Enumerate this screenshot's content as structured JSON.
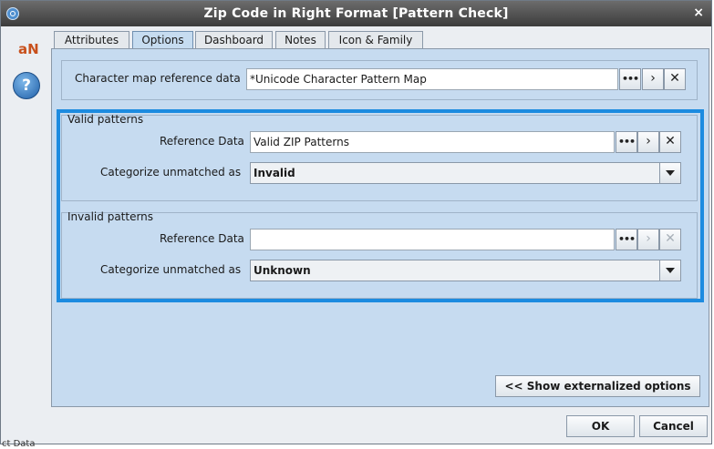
{
  "window": {
    "title": "Zip Code in Right Format [Pattern Check]",
    "close_symbol": "×",
    "title_icon": "app-icon"
  },
  "sidebar": {
    "logo_text": "aN",
    "help_symbol": "?"
  },
  "tabs": [
    {
      "label": "Attributes"
    },
    {
      "label": "Options",
      "active": true
    },
    {
      "label": "Dashboard"
    },
    {
      "label": "Notes"
    },
    {
      "label": "Icon & Family"
    }
  ],
  "options": {
    "char_map": {
      "label": "Character map reference data",
      "value": "*Unicode Character Pattern Map"
    },
    "valid_patterns": {
      "title": "Valid patterns",
      "ref_label": "Reference Data",
      "ref_value": "Valid ZIP Patterns",
      "unmatched_label": "Categorize unmatched as",
      "unmatched_value": "Invalid"
    },
    "invalid_patterns": {
      "title": "Invalid patterns",
      "ref_label": "Reference Data",
      "ref_value": "",
      "unmatched_label": "Categorize unmatched as",
      "unmatched_value": "Unknown"
    },
    "show_externalized_label": "<< Show externalized options"
  },
  "buttons": {
    "ellipsis": "•••",
    "navigate": "›",
    "clear": "✕"
  },
  "footer": {
    "ok_label": "OK",
    "cancel_label": "Cancel"
  },
  "background": {
    "fragment": "ct Data"
  },
  "colors": {
    "highlight": "#1c8be0",
    "panel": "#c6dbf0",
    "titlebar": "#3c3c3c"
  }
}
